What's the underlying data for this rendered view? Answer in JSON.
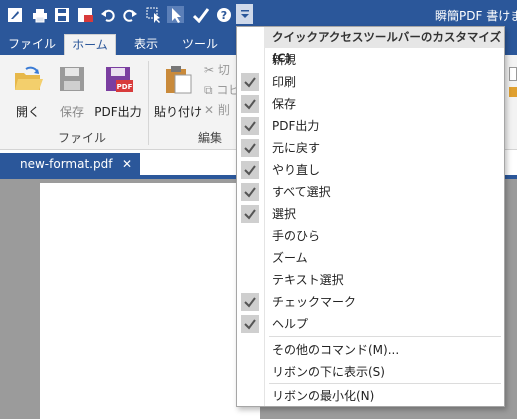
{
  "app": {
    "title": "瞬簡PDF 書けま"
  },
  "tabs": [
    {
      "label": "ファイル"
    },
    {
      "label": "ホーム"
    },
    {
      "label": "表示"
    },
    {
      "label": "ツール"
    }
  ],
  "ribbon": {
    "open_label": "開く",
    "save_label": "保存",
    "pdf_output_label": "PDF出力",
    "paste_label": "貼り付け",
    "cut_label": "切",
    "copy_label": "コピ",
    "delete_label": "削",
    "group_file": "ファイル",
    "group_edit": "編集"
  },
  "document": {
    "tab_name": "new-format.pdf",
    "close_glyph": "✕"
  },
  "qat_menu": {
    "header": "クイックアクセスツールバーのカスタマイズ(C)",
    "items": [
      {
        "label": "新規",
        "checked": false
      },
      {
        "label": "印刷",
        "checked": true
      },
      {
        "label": "保存",
        "checked": true
      },
      {
        "label": "PDF出力",
        "checked": true
      },
      {
        "label": "元に戻す",
        "checked": true
      },
      {
        "label": "やり直し",
        "checked": true
      },
      {
        "label": "すべて選択",
        "checked": true
      },
      {
        "label": "選択",
        "checked": true
      },
      {
        "label": "手のひら",
        "checked": false
      },
      {
        "label": "ズーム",
        "checked": false
      },
      {
        "label": "テキスト選択",
        "checked": false
      },
      {
        "label": "チェックマーク",
        "checked": true
      },
      {
        "label": "ヘルプ",
        "checked": true
      }
    ],
    "more_commands": "その他のコマンド(M)...",
    "show_below": "リボンの下に表示(S)",
    "minimize": "リボンの最小化(N)"
  },
  "colors": {
    "accent": "#2b579a",
    "ribbon_bg": "#f3f3f3",
    "check_bg": "#cfcfcf",
    "workarea": "#9b9b9b"
  },
  "icons": [
    "app-logo-icon",
    "print-icon",
    "save-icon",
    "pdf-icon",
    "undo-icon",
    "redo-icon",
    "select-all-icon",
    "pointer-icon",
    "checkmark-icon",
    "help-icon",
    "dropdown-icon"
  ]
}
